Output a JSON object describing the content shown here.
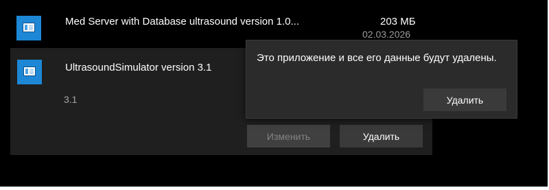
{
  "apps": [
    {
      "name": "Med Server with Database ultrasound version 1.0...",
      "size": "203 МБ",
      "date": "02.03.2026",
      "icon": "app-window-icon"
    },
    {
      "name": "UltrasoundSimulator version 3.1",
      "version": "3.1",
      "icon": "app-window-icon",
      "buttons": {
        "modify": "Изменить",
        "uninstall": "Удалить"
      }
    }
  ],
  "flyout": {
    "message": "Это приложение и все его данные будут удалены.",
    "confirm": "Удалить"
  },
  "colors": {
    "background": "#000000",
    "selected_row": "#1f1f1f",
    "flyout": "#2b2b2b",
    "button": "#3a3a3a",
    "icon_accent": "#1d87d6"
  }
}
